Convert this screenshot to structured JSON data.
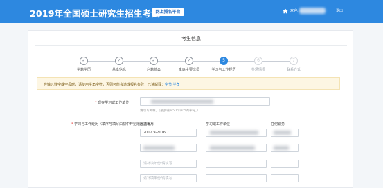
{
  "header": {
    "title": "2019年全国硕士研究生招生考试",
    "badge": "网上报名平台",
    "welcome_label": "欢迎:",
    "username": "",
    "exit_label": "退出"
  },
  "page": {
    "section_title": "考生信息"
  },
  "steps": [
    {
      "label": "学籍学历",
      "glyph": "✓",
      "state": "done"
    },
    {
      "label": "基本信息",
      "glyph": "✓",
      "state": "done"
    },
    {
      "label": "户籍档案",
      "glyph": "✓",
      "state": "done"
    },
    {
      "label": "家庭主要成员",
      "glyph": "✓",
      "state": "done"
    },
    {
      "label": "学习与工作经历",
      "glyph": "5",
      "state": "active"
    },
    {
      "label": "奖惩情况",
      "glyph": "6",
      "state": "todo"
    },
    {
      "label": "联系方式",
      "glyph": "7",
      "state": "todo"
    }
  ],
  "notice": {
    "text": "在输入数字或字母时，请使用半角字符，否则可能会造成报名失败；已读解释：",
    "link1": "字节",
    "link2": "半角"
  },
  "form": {
    "current_unit_label": "现在学习或工作单位：",
    "current_unit_hint": "请勿写简称。（最多输入50个字节的字符。）",
    "history_label": "学习与工作经历（填序号填写由初中开始顺序填写）：",
    "columns": {
      "period": "起止年月",
      "unit": "学习或工作单位",
      "position": "任何职务"
    },
    "rows": [
      {
        "period": "2012.9-2016.7",
        "period_placeholder": "",
        "unit": "",
        "position": ""
      },
      {
        "period": "",
        "period_placeholder": "",
        "unit": "",
        "position": ""
      },
      {
        "period": "",
        "period_placeholder": "请补填年份/请填写",
        "unit": "",
        "position": ""
      },
      {
        "period": "",
        "period_placeholder": "请补填年份/请填写",
        "unit": "",
        "position": ""
      }
    ]
  },
  "colors": {
    "topbar": "#2d88e0",
    "active_step": "#2d88e0",
    "notice_bg": "#fdf6e3",
    "required": "#e53935"
  }
}
